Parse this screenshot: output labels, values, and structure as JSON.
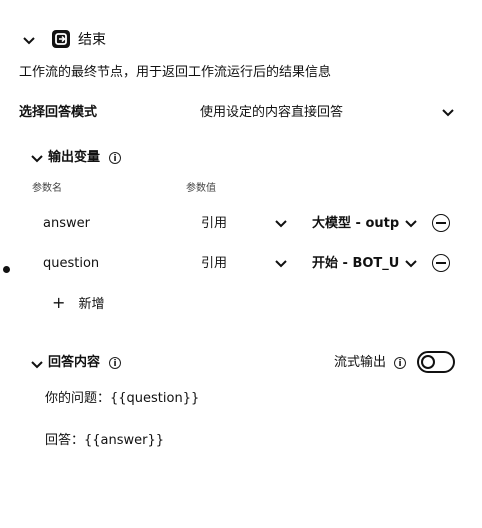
{
  "node": {
    "title": "结束",
    "description": "工作流的最终节点，用于返回工作流运行后的结果信息",
    "icon": "end-node-icon"
  },
  "answer_mode": {
    "label": "选择回答模式",
    "value": "使用设定的内容直接回答"
  },
  "output_vars": {
    "title": "输出变量",
    "col_name": "参数名",
    "col_value": "参数值",
    "rows": [
      {
        "name": "answer",
        "type": "引用",
        "value": "大模型 - outp"
      },
      {
        "name": "question",
        "type": "引用",
        "value": "开始 - BOT_U"
      }
    ],
    "add_label": "新增"
  },
  "answer_content": {
    "title": "回答内容",
    "stream_label": "流式输出",
    "stream_enabled": false,
    "lines": [
      "你的问题：{{question}}",
      "回答：{{answer}}"
    ]
  }
}
